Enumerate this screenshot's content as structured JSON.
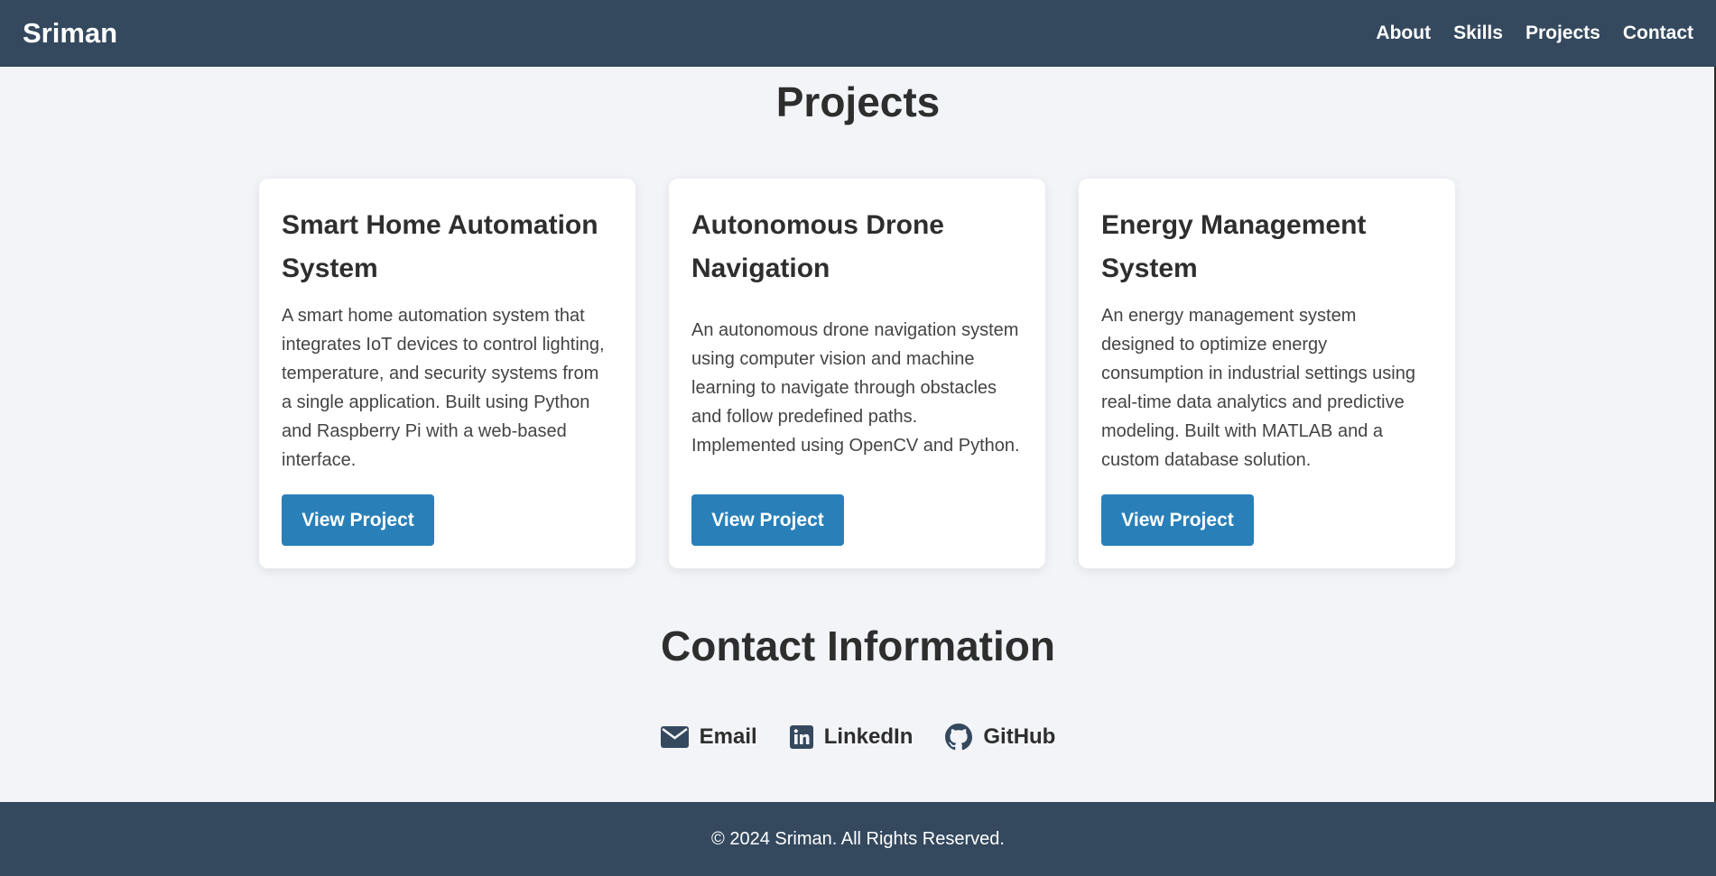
{
  "navbar": {
    "brand": "Sriman",
    "links": [
      "About",
      "Skills",
      "Projects",
      "Contact"
    ]
  },
  "projects": {
    "title": "Projects",
    "cards": [
      {
        "title": "Smart Home Automation System",
        "description": "A smart home automation system that integrates IoT devices to control lighting, temperature, and security systems from a single application. Built using Python and Raspberry Pi with a web-based interface.",
        "button": "View Project"
      },
      {
        "title": "Autonomous Drone Navigation",
        "description": "An autonomous drone navigation system using computer vision and machine learning to navigate through obstacles and follow predefined paths. Implemented using OpenCV and Python.",
        "button": "View Project"
      },
      {
        "title": "Energy Management System",
        "description": "An energy management system designed to optimize energy consumption in industrial settings using real-time data analytics and predictive modeling. Built with MATLAB and a custom database solution.",
        "button": "View Project"
      }
    ]
  },
  "contact": {
    "title": "Contact Information",
    "links": [
      {
        "label": "Email",
        "icon": "envelope-icon"
      },
      {
        "label": "LinkedIn",
        "icon": "linkedin-icon"
      },
      {
        "label": "GitHub",
        "icon": "github-icon"
      }
    ]
  },
  "footer": {
    "text": "© 2024 Sriman. All Rights Reserved."
  },
  "colors": {
    "nav_bg": "#34495e",
    "page_bg": "#f3f4f8",
    "button_bg": "#2980b9"
  }
}
